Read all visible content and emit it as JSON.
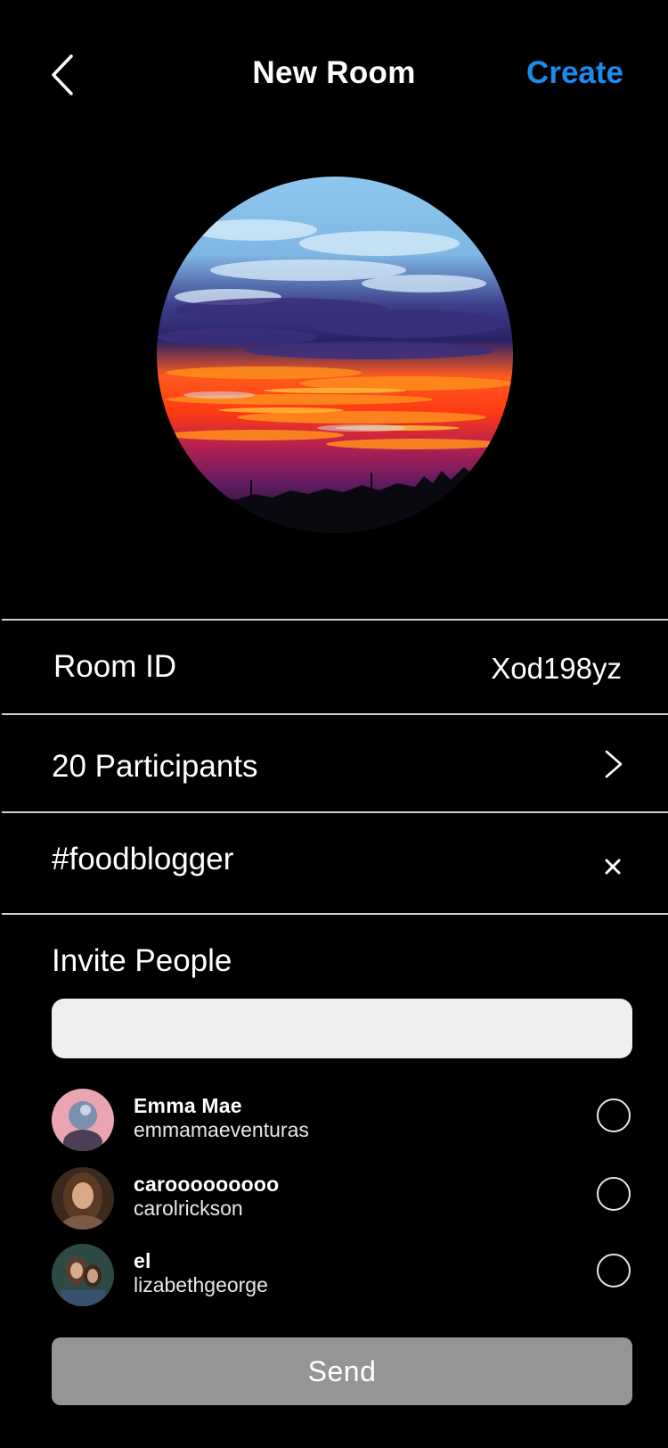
{
  "header": {
    "back_icon": "chevron-left-icon",
    "title": "New Room",
    "create_label": "Create",
    "accent_color": "#1a8cf0"
  },
  "room": {
    "image_description_icon": "sunset-photo",
    "room_id_label": "Room ID",
    "room_id_value": "Xod198yz",
    "participants_label": "20 Participants",
    "participants_icon": "chevron-right-icon",
    "hashtag": "#foodblogger",
    "remove_hashtag_icon": "close-icon"
  },
  "invite": {
    "title": "Invite People",
    "search_placeholder": "",
    "contacts": [
      {
        "name": "Emma Mae",
        "handle": "emmamaeventuras"
      },
      {
        "name": "carooooooooo",
        "handle": "carolrickson"
      },
      {
        "name": "el",
        "handle": "lizabethgeorge"
      }
    ]
  },
  "footer": {
    "send_label": "Send"
  }
}
